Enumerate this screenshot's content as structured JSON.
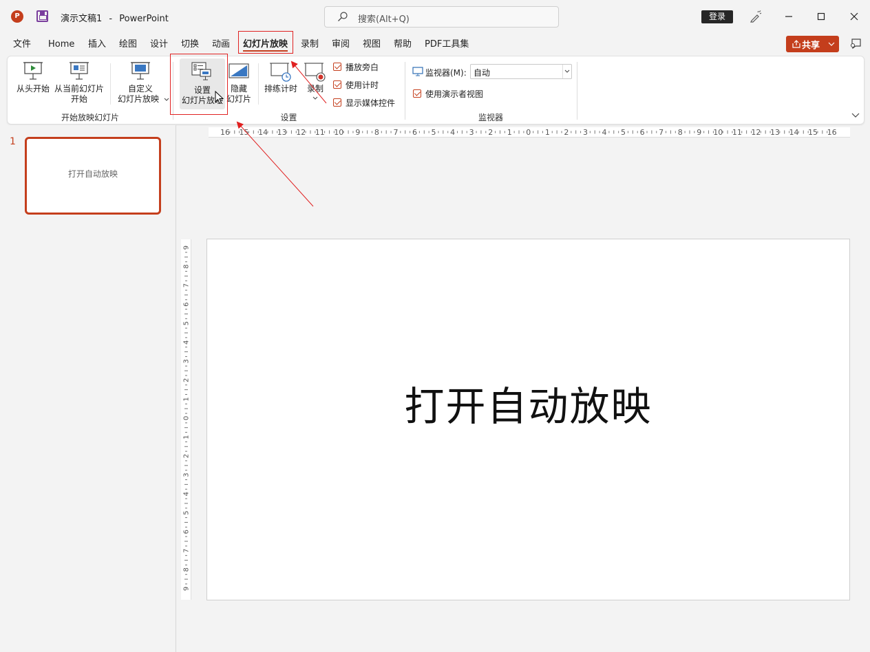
{
  "titlebar": {
    "app_icon": "P",
    "doc_name": "演示文稿1",
    "separator": "-",
    "app_name": "PowerPoint",
    "search_placeholder": "搜索(Alt+Q)",
    "login_label": "登录"
  },
  "tabs": [
    "文件",
    "Home",
    "插入",
    "绘图",
    "设计",
    "切换",
    "动画",
    "幻灯片放映",
    "录制",
    "审阅",
    "视图",
    "帮助",
    "PDF工具集"
  ],
  "active_tab": "幻灯片放映",
  "share_label": "共享",
  "ribbon": {
    "start_group": {
      "label": "开始放映幻灯片",
      "from_beginning": "从头开始",
      "from_current_1": "从当前幻灯片",
      "from_current_2": "开始",
      "custom_1": "自定义",
      "custom_2": "幻灯片放映"
    },
    "setup_group": {
      "label": "设置",
      "setup_1": "设置",
      "setup_2": "幻灯片放映",
      "hide_1": "隐藏",
      "hide_2": "幻灯片",
      "rehearse": "排练计时",
      "record": "录制",
      "chk_narration": "播放旁白",
      "chk_timings": "使用计时",
      "chk_media": "显示媒体控件"
    },
    "monitor_group": {
      "label": "监视器",
      "monitor_label": "监视器(M):",
      "monitor_value": "自动",
      "presenter_view": "使用演示者视图"
    }
  },
  "slides_pane": {
    "slide_number": "1",
    "thumb_text": "打开自动放映"
  },
  "slide": {
    "title_text": "打开自动放映"
  },
  "rulers": {
    "horizontal_ticks": [
      "16",
      "15",
      "14",
      "13",
      "12",
      "11",
      "10",
      "9",
      "8",
      "7",
      "6",
      "5",
      "4",
      "3",
      "2",
      "1",
      "0",
      "1",
      "2",
      "3",
      "4",
      "5",
      "6",
      "7",
      "8",
      "9",
      "10",
      "11",
      "12",
      "13",
      "14",
      "15",
      "16"
    ],
    "vertical_ticks": [
      "9",
      "8",
      "7",
      "6",
      "5",
      "4",
      "3",
      "2",
      "1",
      "0",
      "1",
      "2",
      "3",
      "4",
      "5",
      "6",
      "7",
      "8",
      "9"
    ]
  },
  "colors": {
    "accent": "#c43e1c",
    "annotation": "#e02020"
  }
}
